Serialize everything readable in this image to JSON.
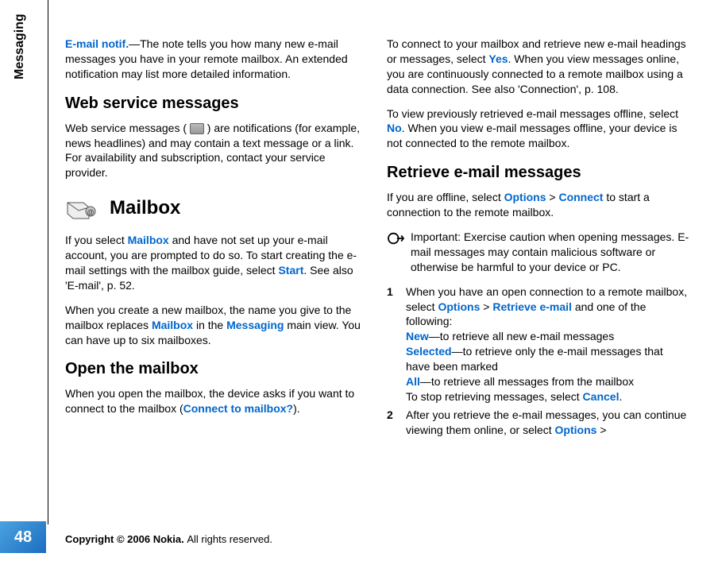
{
  "side": {
    "label": "Messaging",
    "pageNum": "48"
  },
  "col1": {
    "emailNotifLabel": "E-mail notif.",
    "emailNotifRest": "—The note tells you how many new e-mail messages you have in your remote mailbox. An extended notification may list more detailed information.",
    "webHeading": "Web service messages",
    "webText1": "Web service messages ( ",
    "webText2": " ) are notifications (for example, news headlines) and may contain a text message or a link. For availability and subscription, contact your service provider.",
    "mailboxHeading": "Mailbox",
    "mbP1a": "If you select ",
    "mbP1Link1": "Mailbox",
    "mbP1b": " and have not set up your e-mail account, you are prompted to do so. To start creating the e-mail settings with the mailbox guide, select ",
    "mbP1Link2": "Start",
    "mbP1c": ". See also 'E-mail', p. 52.",
    "mbP2a": "When you create a new mailbox, the name you give to the mailbox replaces ",
    "mbP2Link1": "Mailbox",
    "mbP2b": " in the ",
    "mbP2Link2": "Messaging",
    "mbP2c": " main view. You can have up to six mailboxes.",
    "openHeading": "Open the mailbox",
    "openP1a": "When you open the mailbox, the device asks if you want to connect to the mailbox (",
    "openP1Link": "Connect to mailbox?",
    "openP1b": ")."
  },
  "col2": {
    "connP1a": "To connect to your mailbox and retrieve new e-mail headings or messages, select ",
    "connP1Link": "Yes",
    "connP1b": ". When you view messages online, you are continuously connected to a remote mailbox using a data connection. See also 'Connection', p. 108.",
    "connP2a": "To view previously retrieved e-mail messages offline, select ",
    "connP2Link": "No",
    "connP2b": ". When you view e-mail messages offline, your device is not connected to the remote mailbox.",
    "retrHeading": "Retrieve e-mail messages",
    "retrP1a": "If you are offline, select ",
    "retrP1Link1": "Options",
    "retrP1b": " > ",
    "retrP1Link2": "Connect",
    "retrP1c": " to start a connection to the remote mailbox.",
    "importantPrefix": "Important: ",
    "importantText": "Exercise caution when opening messages. E-mail messages may contain malicious software or otherwise be harmful to your device or PC.",
    "step1num": "1",
    "step1a": "When you have an open connection to a remote mailbox, select ",
    "step1Link1": "Options",
    "step1b": " > ",
    "step1Link2": "Retrieve e-mail",
    "step1c": " and one of the following:",
    "newLabel": "New",
    "newText": "—to retrieve all new e-mail messages",
    "selLabel": "Selected",
    "selText": "—to retrieve only the e-mail messages that have been marked",
    "allLabel": "All",
    "allText": "—to retrieve all messages from the mailbox",
    "stopA": "To stop retrieving messages, select ",
    "stopLink": "Cancel",
    "stopB": ".",
    "step2num": "2",
    "step2a": "After you retrieve the e-mail messages, you can continue viewing them online, or select ",
    "step2Link": "Options",
    "step2b": " >"
  },
  "footer": {
    "bold": "Copyright © 2006 Nokia. ",
    "rest": "All rights reserved."
  }
}
